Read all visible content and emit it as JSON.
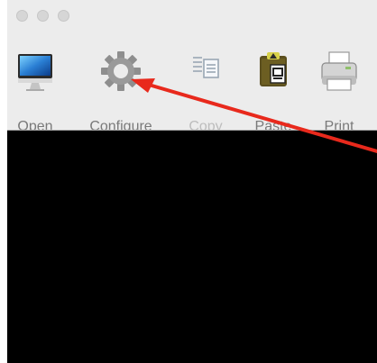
{
  "window": {
    "traffic_lights": [
      "close",
      "minimize",
      "zoom"
    ]
  },
  "toolbar": {
    "items": [
      {
        "label": "Open",
        "icon": "imac-icon",
        "enabled": true
      },
      {
        "label": "Configure",
        "icon": "gear-icon",
        "enabled": true
      },
      {
        "label": "Copy",
        "icon": "copy-icon",
        "enabled": false
      },
      {
        "label": "Paste",
        "icon": "clipboard-paste-icon",
        "enabled": true
      },
      {
        "label": "Print",
        "icon": "printer-icon",
        "enabled": true
      }
    ]
  },
  "terminal": {
    "background": "#000000"
  },
  "annotation": {
    "color": "#e8291c",
    "points_to": "Configure"
  }
}
